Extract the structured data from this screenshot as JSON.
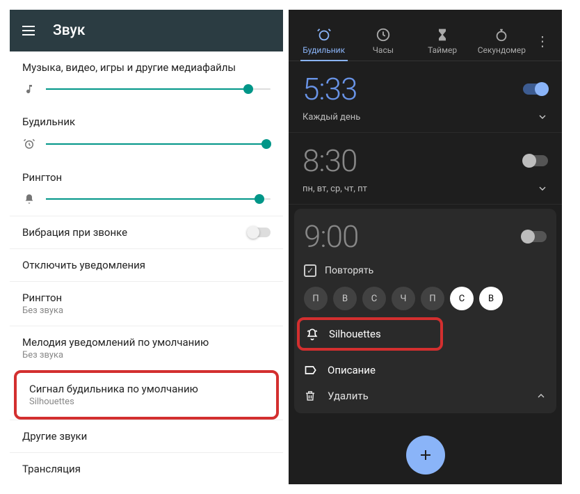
{
  "left": {
    "title": "Звук",
    "sliders": {
      "media_label": "Музыка, видео, игры и другие медиафайлы",
      "media_value": 90,
      "alarm_label": "Будильник",
      "alarm_value": 98,
      "ring_label": "Рингтон",
      "ring_value": 95
    },
    "vibrate_label": "Вибрация при звонке",
    "dnd_label": "Отключить уведомления",
    "ringtone": {
      "title": "Рингтон",
      "sub": "Без звука"
    },
    "notif": {
      "title": "Мелодия уведомлений по умолчанию",
      "sub": "Без звука"
    },
    "alarm_sound": {
      "title": "Сигнал будильника по умолчанию",
      "sub": "Silhouettes"
    },
    "other_label": "Другие звуки",
    "cast_label": "Трансляция"
  },
  "right": {
    "tabs": {
      "alarm": "Будильник",
      "clock": "Часы",
      "timer": "Таймер",
      "stopwatch": "Секундомер"
    },
    "alarms": [
      {
        "time": "5:33",
        "days": "Каждый день",
        "on": true
      },
      {
        "time": "8:30",
        "days": "пн, вт, ср, чт, пт",
        "on": false
      },
      {
        "time": "9:00",
        "on": false,
        "expanded": true,
        "repeat": "Повторять",
        "day_chips": [
          "П",
          "В",
          "С",
          "Ч",
          "П",
          "С",
          "В"
        ],
        "active_days": [
          5,
          6
        ],
        "ringtone": "Silhouettes",
        "desc": "Описание",
        "delete": "Удалить"
      }
    ]
  }
}
